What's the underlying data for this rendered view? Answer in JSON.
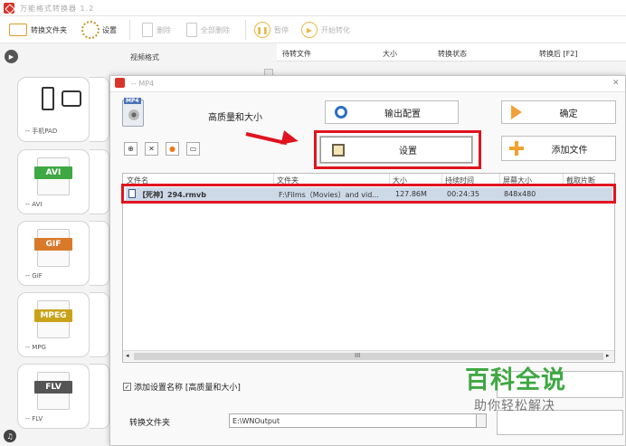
{
  "app": {
    "title": "万能格式转换器 1.2"
  },
  "toolbar": {
    "convert_folder": "转换文件夹",
    "settings": "设置",
    "delete": "删除",
    "delete_all": "全部删除",
    "pause": "暂停",
    "start_convert": "开始转化"
  },
  "left_panel": {
    "header": "视频格式",
    "tiles": [
      {
        "label": "-- 手机PAD"
      },
      {
        "label": "-- AVI",
        "badge": "AVI",
        "color": "#3fa843"
      },
      {
        "label": "-- GIF",
        "badge": "GIF",
        "color": "#d97a2b"
      },
      {
        "label": "-- MPG",
        "badge": "MPEG",
        "color": "#caa21a"
      },
      {
        "label": "-- FLV",
        "badge": "FLV",
        "color": "#555555"
      }
    ]
  },
  "list_header": {
    "file": "待转文件",
    "size": "大小",
    "status": "转换状态",
    "after": "转换后 [F2]"
  },
  "dialog": {
    "title": "-- MP4",
    "quality": "高质量和大小",
    "output_config": "输出配置",
    "ok": "确定",
    "settings": "设置",
    "add_file": "添加文件",
    "columns": {
      "name": "文件名",
      "folder": "文件夹",
      "size": "大小",
      "duration": "持续时间",
      "screen": "屏幕大小",
      "clip": "截取片断"
    },
    "file_row": {
      "name": "【死神】294.rmvb",
      "folder": "F:\\Films（Movies）and vid...",
      "size": "127.86M",
      "duration": "00:24:35",
      "screen": "848x480"
    },
    "scroll_marker": "III",
    "add_name_label": "添加设置名称 [高质量和大小]",
    "output_folder_label": "转换文件夹",
    "output_folder_value": "E:\\WNOutput"
  },
  "watermark": {
    "title": "百科全说",
    "subtitle": "助你轻松解决"
  },
  "accent": "#e0141f"
}
